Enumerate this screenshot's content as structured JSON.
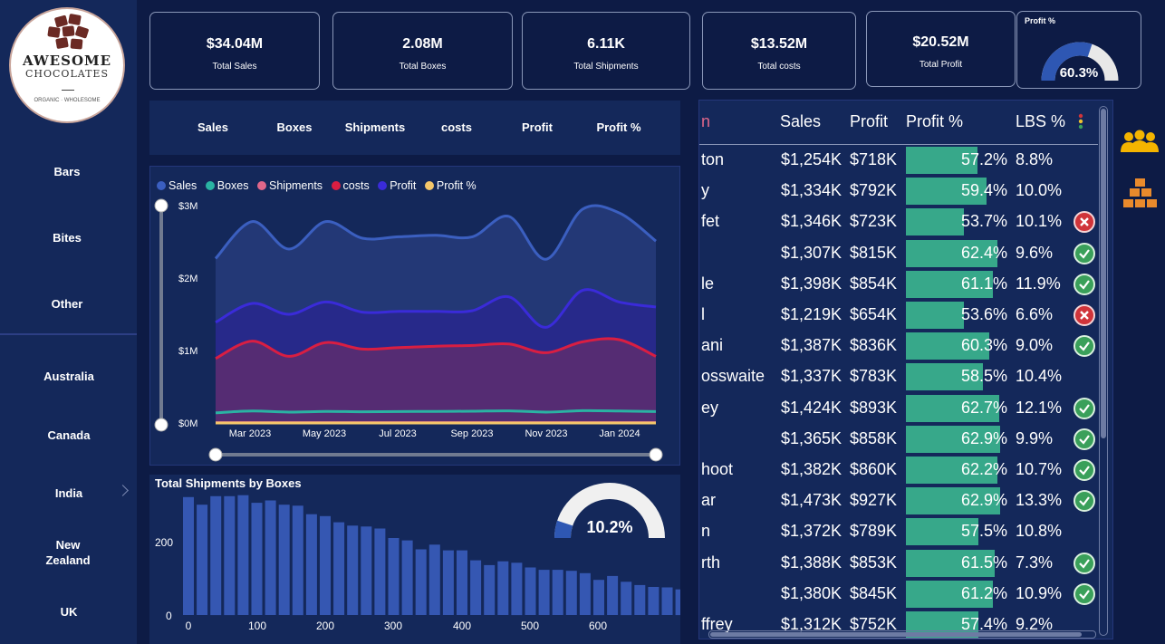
{
  "logo": {
    "line1": "AWESOME",
    "line2": "CHOCOLATES",
    "tagline": "ORGANIC · WHOLESOME"
  },
  "sidebar": {
    "categories": [
      "Bars",
      "Bites",
      "Other"
    ],
    "countries": [
      "Australia",
      "Canada",
      "India",
      "New Zealand",
      "UK"
    ]
  },
  "kpis": [
    {
      "value": "$34.04M",
      "label": "Total Sales"
    },
    {
      "value": "2.08M",
      "label": "Total Boxes"
    },
    {
      "value": "6.11K",
      "label": "Total Shipments"
    },
    {
      "value": "$13.52M",
      "label": "Total costs"
    },
    {
      "value": "$20.52M",
      "label": "Total Profit"
    }
  ],
  "profit_gauge": {
    "title": "Profit %",
    "value": "60.3%",
    "fraction": 0.603,
    "fill_color": "#2e57b3"
  },
  "metric_tabs": [
    "Sales",
    "Boxes",
    "Shipments",
    "costs",
    "Profit",
    "Profit %"
  ],
  "line_chart": {
    "legend": [
      {
        "name": "Sales",
        "color": "#3b5fc0"
      },
      {
        "name": "Boxes",
        "color": "#2ab3a3"
      },
      {
        "name": "Shipments",
        "color": "#e0678a"
      },
      {
        "name": "costs",
        "color": "#d91e42"
      },
      {
        "name": "Profit",
        "color": "#3a2bd9"
      },
      {
        "name": "Profit %",
        "color": "#f5c76a"
      }
    ],
    "y_ticks": [
      "$3M",
      "$2M",
      "$1M",
      "$0M"
    ],
    "x_ticks": [
      "Mar 2023",
      "May 2023",
      "Jul 2023",
      "Sep 2023",
      "Nov 2023",
      "Jan 2024"
    ]
  },
  "chart_data": [
    {
      "type": "area",
      "title": "",
      "x": [
        "Feb 2023",
        "Mar 2023",
        "Apr 2023",
        "May 2023",
        "Jun 2023",
        "Jul 2023",
        "Aug 2023",
        "Sep 2023",
        "Oct 2023",
        "Nov 2023",
        "Dec 2023",
        "Jan 2024",
        "Feb 2024"
      ],
      "ylim": [
        0,
        3000000
      ],
      "series": [
        {
          "name": "Sales",
          "values": [
            2270000,
            2780000,
            2400000,
            2780000,
            2550000,
            2570000,
            2590000,
            2570000,
            2850000,
            2260000,
            2950000,
            2900000,
            2510000
          ]
        },
        {
          "name": "Profit",
          "values": [
            1390000,
            1650000,
            1500000,
            1670000,
            1530000,
            1540000,
            1540000,
            1550000,
            1740000,
            1320000,
            1830000,
            1670000,
            1600000
          ]
        },
        {
          "name": "costs",
          "values": [
            890000,
            1130000,
            920000,
            1110000,
            1020000,
            1040000,
            1060000,
            1070000,
            1090000,
            970000,
            1120000,
            1150000,
            920000
          ]
        },
        {
          "name": "Boxes",
          "values": [
            140000,
            165000,
            150000,
            160000,
            155000,
            158000,
            160000,
            162000,
            168000,
            150000,
            170000,
            165000,
            158000
          ]
        },
        {
          "name": "Shipments",
          "values": [
            5000,
            5000,
            5000,
            5000,
            5000,
            5000,
            5000,
            5000,
            5000,
            5000,
            5000,
            5000,
            5000
          ]
        },
        {
          "name": "Profit %",
          "values": [
            600,
            600,
            600,
            600,
            600,
            600,
            600,
            600,
            600,
            600,
            600,
            600,
            600
          ]
        }
      ]
    },
    {
      "type": "bar",
      "title": "Total Shipments by Boxes",
      "x_ticks": [
        "0",
        "100",
        "200",
        "300",
        "400",
        "500",
        "600"
      ],
      "y_ticks": [
        "200",
        "0"
      ],
      "ylim": [
        0,
        250
      ],
      "x": [
        0,
        20,
        40,
        60,
        80,
        100,
        120,
        140,
        160,
        180,
        200,
        220,
        240,
        260,
        280,
        300,
        320,
        340,
        360,
        380,
        400,
        420,
        440,
        460,
        480,
        500,
        520,
        540,
        560,
        580,
        600,
        620,
        640,
        660,
        680
      ],
      "values": [
        248,
        232,
        250,
        250,
        252,
        236,
        241,
        232,
        230,
        212,
        208,
        195,
        188,
        186,
        182,
        162,
        157,
        138,
        148,
        136,
        136,
        115,
        105,
        113,
        110,
        100,
        95,
        95,
        93,
        88,
        74,
        82,
        70,
        63,
        59,
        58,
        54,
        49
      ]
    }
  ],
  "shipments_gauge": {
    "value": "10.2%",
    "fraction": 0.102,
    "fill_color": "#2e57b3"
  },
  "table": {
    "headers": [
      "Sales",
      "Profit",
      "Profit %",
      "LBS %"
    ],
    "partial_header": "n",
    "rows": [
      {
        "name": "ton",
        "sales": "$1,254K",
        "profit": "$718K",
        "pct": "57.2%",
        "pct_value": 57.2,
        "lbs": "8.8%",
        "status": ""
      },
      {
        "name": "y",
        "sales": "$1,334K",
        "profit": "$792K",
        "pct": "59.4%",
        "pct_value": 59.4,
        "lbs": "10.0%",
        "status": ""
      },
      {
        "name": "fet",
        "sales": "$1,346K",
        "profit": "$723K",
        "pct": "53.7%",
        "pct_value": 53.7,
        "lbs": "10.1%",
        "status": "bad"
      },
      {
        "name": "",
        "sales": "$1,307K",
        "profit": "$815K",
        "pct": "62.4%",
        "pct_value": 62.4,
        "lbs": "9.6%",
        "status": "good"
      },
      {
        "name": "le",
        "sales": "$1,398K",
        "profit": "$854K",
        "pct": "61.1%",
        "pct_value": 61.1,
        "lbs": "11.9%",
        "status": "good"
      },
      {
        "name": "l",
        "sales": "$1,219K",
        "profit": "$654K",
        "pct": "53.6%",
        "pct_value": 53.6,
        "lbs": "6.6%",
        "status": "bad"
      },
      {
        "name": "ani",
        "sales": "$1,387K",
        "profit": "$836K",
        "pct": "60.3%",
        "pct_value": 60.3,
        "lbs": "9.0%",
        "status": "good"
      },
      {
        "name": "osswaite",
        "sales": "$1,337K",
        "profit": "$783K",
        "pct": "58.5%",
        "pct_value": 58.5,
        "lbs": "10.4%",
        "status": ""
      },
      {
        "name": "ey",
        "sales": "$1,424K",
        "profit": "$893K",
        "pct": "62.7%",
        "pct_value": 62.7,
        "lbs": "12.1%",
        "status": "good"
      },
      {
        "name": "",
        "sales": "$1,365K",
        "profit": "$858K",
        "pct": "62.9%",
        "pct_value": 62.9,
        "lbs": "9.9%",
        "status": "good"
      },
      {
        "name": "hoot",
        "sales": "$1,382K",
        "profit": "$860K",
        "pct": "62.2%",
        "pct_value": 62.2,
        "lbs": "10.7%",
        "status": "good"
      },
      {
        "name": "ar",
        "sales": "$1,473K",
        "profit": "$927K",
        "pct": "62.9%",
        "pct_value": 62.9,
        "lbs": "13.3%",
        "status": "good"
      },
      {
        "name": "n",
        "sales": "$1,372K",
        "profit": "$789K",
        "pct": "57.5%",
        "pct_value": 57.5,
        "lbs": "10.8%",
        "status": ""
      },
      {
        "name": "rth",
        "sales": "$1,388K",
        "profit": "$853K",
        "pct": "61.5%",
        "pct_value": 61.5,
        "lbs": "7.3%",
        "status": "good"
      },
      {
        "name": "",
        "sales": "$1,380K",
        "profit": "$845K",
        "pct": "61.2%",
        "pct_value": 61.2,
        "lbs": "10.9%",
        "status": "good"
      },
      {
        "name": "ffrey",
        "sales": "$1,312K",
        "profit": "$752K",
        "pct": "57.4%",
        "pct_value": 57.4,
        "lbs": "9.2%",
        "status": ""
      }
    ]
  },
  "right_icons": [
    "people-icon",
    "boxes-icon"
  ],
  "colors": {
    "accent": "#37a88a",
    "good": "#3aa05a",
    "bad": "#d0343a",
    "navy": "#14285a"
  }
}
